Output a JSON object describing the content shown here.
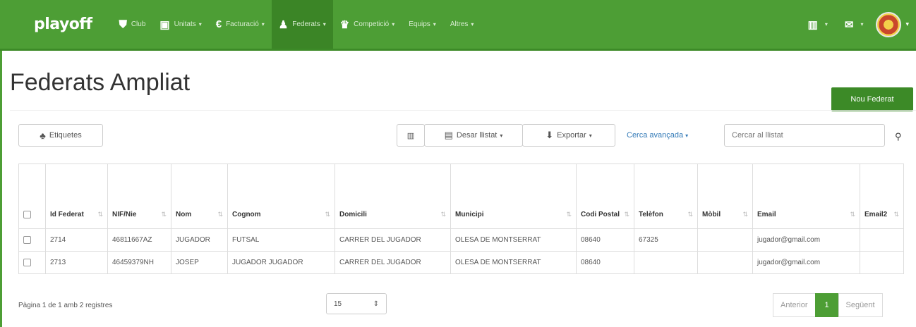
{
  "navbar": {
    "brand": "playoff",
    "items": [
      {
        "icon": "shield-icon",
        "glyph": "⛊",
        "label": "Club",
        "caret": false
      },
      {
        "icon": "id-card-icon",
        "glyph": "▣",
        "label": "Unitats",
        "caret": true
      },
      {
        "icon": "euro-icon",
        "glyph": "€",
        "label": "Facturació",
        "caret": true
      },
      {
        "icon": "user-icon",
        "glyph": "♟",
        "label": "Federats",
        "caret": true
      },
      {
        "icon": "trophy-icon",
        "glyph": "♛",
        "label": "Competició",
        "caret": true
      },
      {
        "icon": "",
        "glyph": "",
        "label": "Equips",
        "caret": true
      },
      {
        "icon": "",
        "glyph": "",
        "label": "Altres",
        "caret": true
      }
    ],
    "caret": "▾",
    "chart_glyph": "▥",
    "mail_glyph": "✉"
  },
  "page": {
    "title": "Federats Ampliat",
    "new_button": "Nou Federat"
  },
  "toolbar": {
    "labels_button": "Etiquetes",
    "labels_glyph": "♣",
    "columns_glyph": "▥",
    "save_list_button": "Desar llistat",
    "save_glyph": "▤",
    "export_button": "Exportar",
    "export_glyph": "⬇",
    "advanced_search": "Cerca avançada",
    "search_placeholder": "Cercar al llistat",
    "search_glyph": "⚲"
  },
  "table": {
    "columns": [
      "Id Federat",
      "NIF/Nie",
      "Nom",
      "Cognom",
      "Domicili",
      "Municipi",
      "Codi Postal",
      "Telèfon",
      "Mòbil",
      "Email",
      "Email2"
    ],
    "sort_glyph": "⇅",
    "rows": [
      [
        "2714",
        "46811667AZ",
        "JUGADOR",
        "FUTSAL",
        "CARRER DEL JUGADOR",
        "OLESA DE MONTSERRAT",
        "08640",
        "67325",
        "",
        "jugador@gmail.com",
        ""
      ],
      [
        "2713",
        "46459379NH",
        "JOSEP",
        "JUGADOR JUGADOR",
        "CARRER DEL JUGADOR",
        "OLESA DE MONTSERRAT",
        "08640",
        "",
        "",
        "jugador@gmail.com",
        ""
      ]
    ]
  },
  "footer": {
    "info": "Pàgina 1 de 1 amb 2 registres",
    "per_page": "15",
    "per_page_glyph": "⇕",
    "prev": "Anterior",
    "current": "1",
    "next": "Següent"
  },
  "colors": {
    "brand_green": "#4d9e35",
    "active_green": "#3b8526",
    "link_blue": "#337ab7"
  }
}
